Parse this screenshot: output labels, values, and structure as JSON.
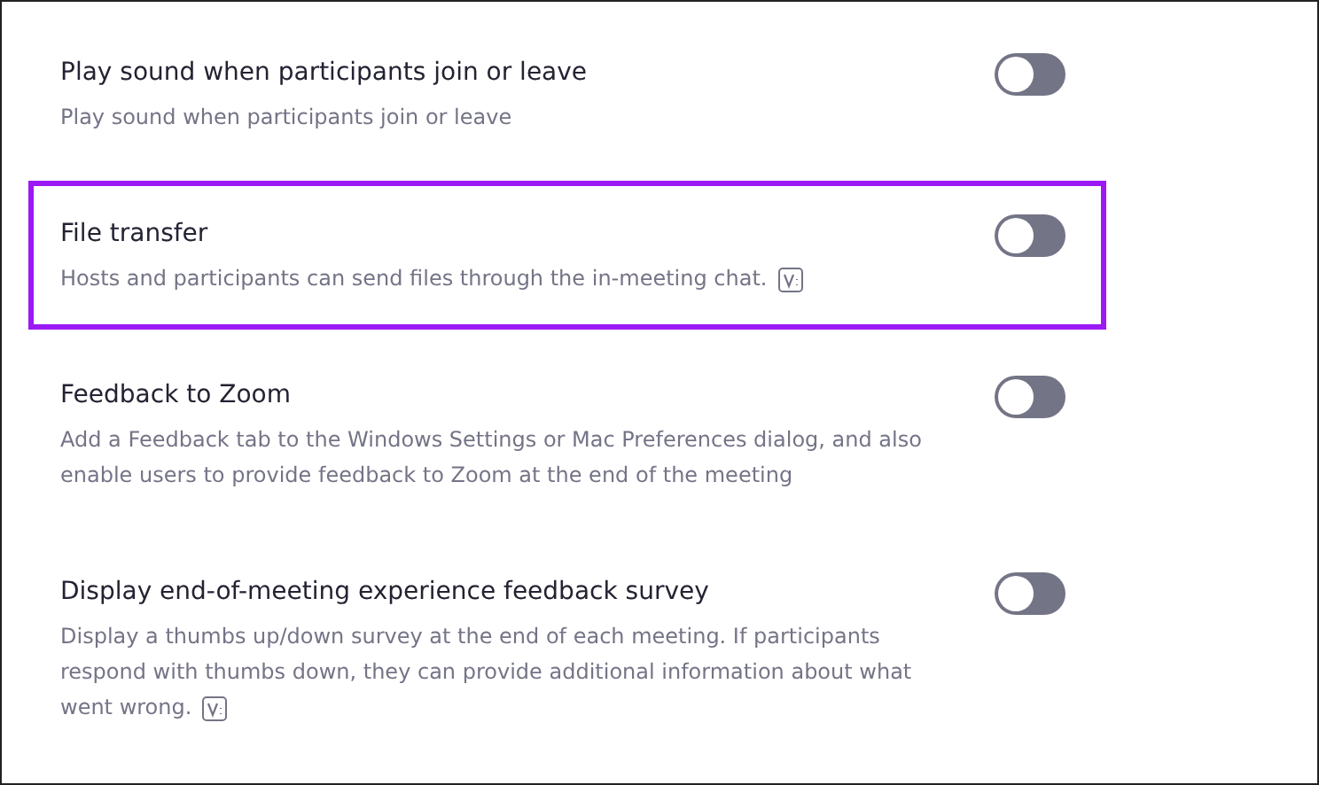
{
  "settings": [
    {
      "title": "Play sound when participants join or leave",
      "description": "Play sound when participants join or leave",
      "version_icon": false,
      "on": false,
      "highlighted": false
    },
    {
      "title": "File transfer",
      "description": "Hosts and participants can send files through the in-meeting chat.",
      "version_icon": true,
      "on": false,
      "highlighted": true
    },
    {
      "title": "Feedback to Zoom",
      "description": "Add a Feedback tab to the Windows Settings or Mac Preferences dialog, and also enable users to provide feedback to Zoom at the end of the meeting",
      "version_icon": false,
      "on": false,
      "highlighted": false
    },
    {
      "title": "Display end-of-meeting experience feedback survey",
      "description": "Display a thumbs up/down survey at the end of each meeting. If participants respond with thumbs down, they can provide additional information about what went wrong.",
      "version_icon": true,
      "on": false,
      "highlighted": false
    }
  ]
}
